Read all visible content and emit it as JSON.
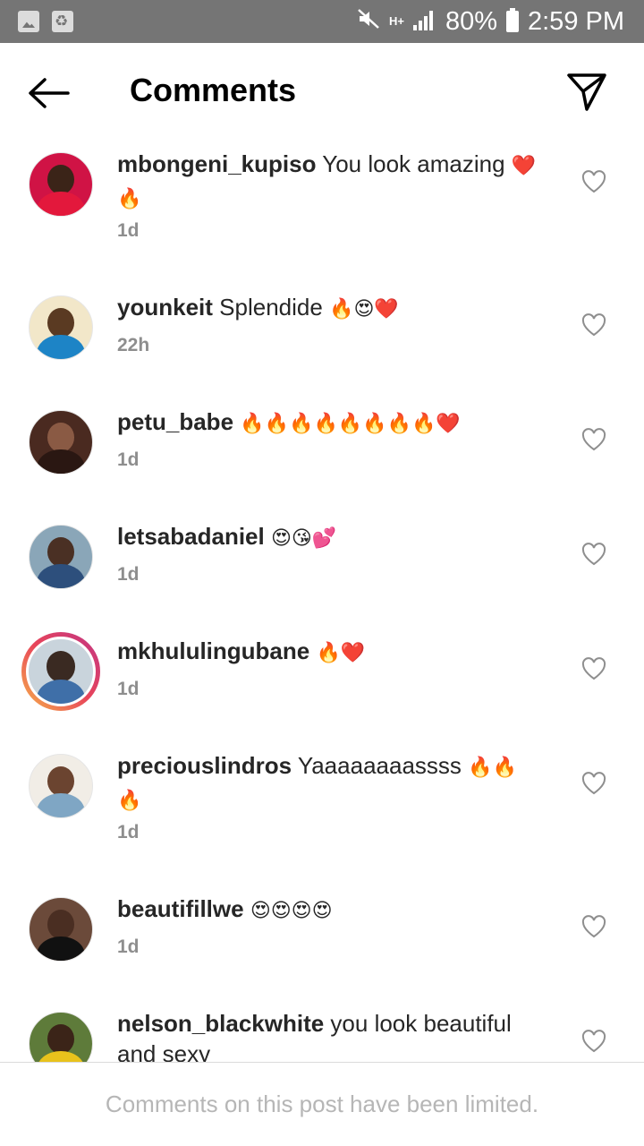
{
  "status_bar": {
    "battery": "80%",
    "time": "2:59 PM",
    "network": "H+"
  },
  "header": {
    "title": "Comments"
  },
  "comments": [
    {
      "username": "mbongeni_kupiso",
      "text": "You look amazing",
      "emoji": "❤️🔥",
      "time": "1d"
    },
    {
      "username": "younkeit",
      "text": "Splendide",
      "emoji": "🔥😍❤️",
      "time": "22h"
    },
    {
      "username": "petu_babe",
      "text": "",
      "emoji": "🔥🔥🔥🔥🔥🔥🔥🔥❤️",
      "time": "1d"
    },
    {
      "username": "letsabadaniel",
      "text": "",
      "emoji": "😍😘💕",
      "time": "1d"
    },
    {
      "username": "mkhululingubane",
      "text": "",
      "emoji": "🔥❤️",
      "time": "1d"
    },
    {
      "username": "preciouslindros",
      "text": "Yaaaaaaaassss",
      "emoji": "🔥🔥🔥",
      "time": "1d"
    },
    {
      "username": "beautifillwe",
      "text": "",
      "emoji": "😍😍😍😍",
      "time": "1d"
    },
    {
      "username": "nelson_blackwhite",
      "text": "you look beautiful and sexy",
      "emoji": "",
      "time": ""
    }
  ],
  "footer": {
    "notice": "Comments on this post have been limited."
  },
  "colors": {
    "status_bar": "#757575",
    "secondary_text": "#8e8e8e",
    "story_ring_start": "#f6b34a",
    "story_ring_end": "#c13584"
  }
}
